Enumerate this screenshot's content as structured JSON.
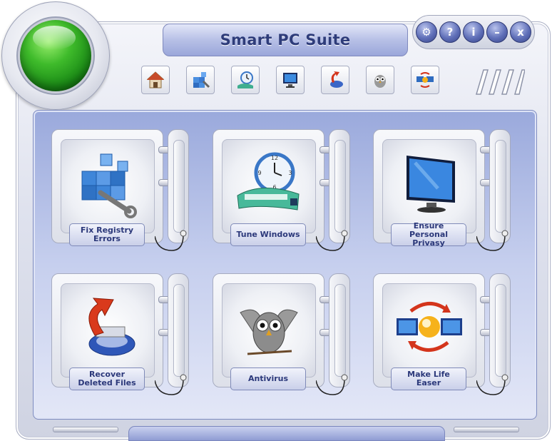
{
  "app": {
    "title": "Smart PC Suite"
  },
  "window_controls": [
    {
      "name": "settings",
      "glyph": "⚙"
    },
    {
      "name": "help",
      "glyph": "?"
    },
    {
      "name": "info",
      "glyph": "i"
    },
    {
      "name": "minimize",
      "glyph": "–"
    },
    {
      "name": "close",
      "glyph": "x"
    }
  ],
  "toolbar": [
    {
      "name": "home-icon"
    },
    {
      "name": "registry-icon"
    },
    {
      "name": "tune-icon"
    },
    {
      "name": "monitor-icon"
    },
    {
      "name": "recover-icon"
    },
    {
      "name": "antivirus-icon"
    },
    {
      "name": "sync-icon"
    }
  ],
  "cards": [
    {
      "label": "Fix Registry Errors",
      "icon": "registry-cubes-icon"
    },
    {
      "label": "Tune Windows",
      "icon": "clock-train-icon"
    },
    {
      "label": "Ensure Personal Privasy",
      "icon": "monitor-icon"
    },
    {
      "label": "Recover Deleted Files",
      "icon": "disk-arrow-icon"
    },
    {
      "label": "Antivirus",
      "icon": "owl-icon"
    },
    {
      "label": "Make Life Easer",
      "icon": "sync-monitors-icon"
    }
  ],
  "colors": {
    "accent": "#2e3c7a",
    "panel": "#b7c0e6",
    "status_orb": "#3fbb2b"
  }
}
